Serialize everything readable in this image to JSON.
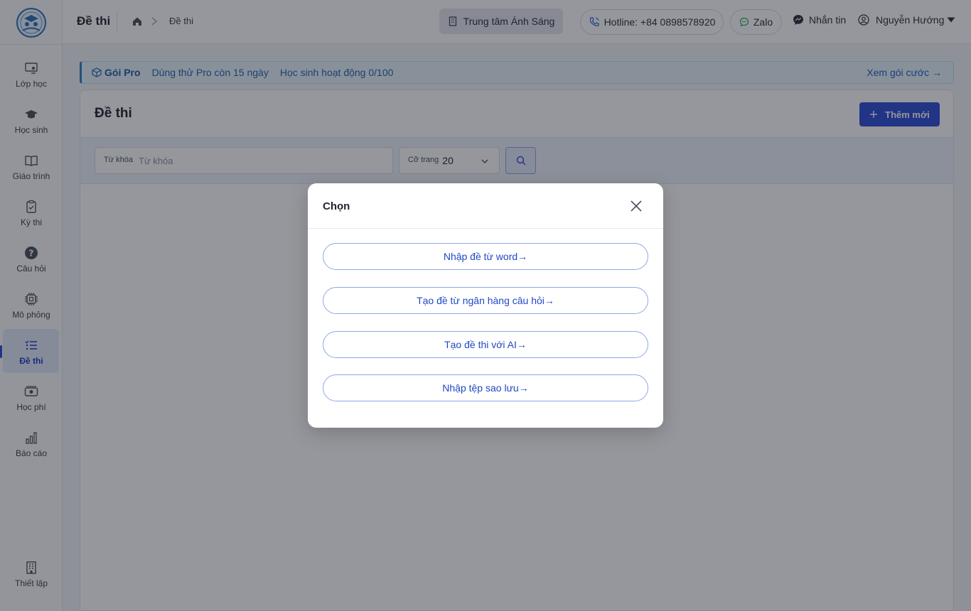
{
  "sidebar": {
    "items": [
      {
        "label": "Lớp học",
        "icon": "classroom-icon"
      },
      {
        "label": "Học sinh",
        "icon": "graduation-cap-icon"
      },
      {
        "label": "Giáo trình",
        "icon": "book-icon"
      },
      {
        "label": "Kỳ thi",
        "icon": "clipboard-check-icon"
      },
      {
        "label": "Câu hỏi",
        "icon": "question-circle-icon"
      },
      {
        "label": "Mô phỏng",
        "icon": "chip-icon"
      },
      {
        "label": "Đề thi",
        "icon": "list-icon",
        "active": true
      },
      {
        "label": "Học phí",
        "icon": "money-icon"
      },
      {
        "label": "Báo cáo",
        "icon": "bar-chart-icon"
      }
    ],
    "settings_label": "Thiết lập"
  },
  "header": {
    "title": "Đề thi",
    "breadcrumb_current": "Đề thi",
    "center_name": "Trung tâm Ánh Sáng",
    "hotline": "Hotline: +84 0898578920",
    "zalo": "Zalo",
    "message": "Nhắn tin",
    "user_name": "Nguyễn Hướng"
  },
  "banner": {
    "plan": "Gói Pro",
    "trial": "Dùng thử Pro còn 15 ngày",
    "students": "Học sinh hoạt động 0/100",
    "link": "Xem gói cước →"
  },
  "main": {
    "title": "Đề thi",
    "add_label": "Thêm mới",
    "keyword_label": "Từ khóa",
    "keyword_placeholder": "Từ khóa",
    "page_size_label": "Cỡ trang",
    "page_size_value": "20"
  },
  "modal": {
    "title": "Chọn",
    "options": [
      "Nhập đề từ word→",
      "Tạo đề từ ngân hàng câu hỏi→",
      "Tạo đề thi với AI→",
      "Nhập tệp sao lưu→"
    ]
  },
  "colors": {
    "primary": "#2f4bd6",
    "active_bg": "#e4e9fb",
    "banner_bg": "#e8f4fb",
    "link": "#1d5fc4"
  }
}
